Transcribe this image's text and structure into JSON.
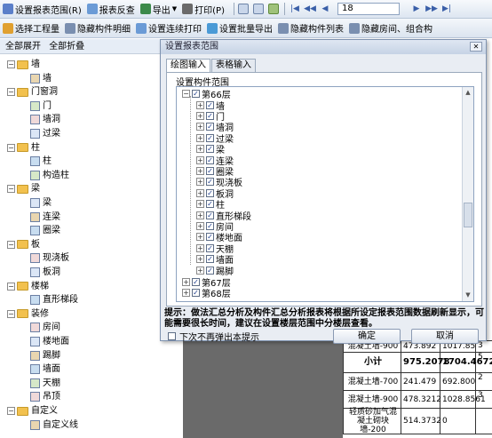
{
  "toolbar1": {
    "items": [
      {
        "label": "设置报表范围(R)",
        "icon": "range-icon",
        "color": "#5b7fc9"
      },
      {
        "label": "报表反查",
        "icon": "reverse-lookup-icon",
        "color": "#6b9bd6"
      },
      {
        "label": "导出",
        "icon": "export-icon",
        "color": "#3c8a4a"
      },
      {
        "label": "打印(P)",
        "icon": "print-icon",
        "color": "#6a6a6a"
      }
    ],
    "page_value": "18"
  },
  "toolbar2": {
    "items": [
      {
        "label": "选择工程量",
        "icon": "select-quantity-icon",
        "color": "#e0a030"
      },
      {
        "label": "隐藏构件明细",
        "icon": "hide-detail-icon",
        "color": "#7a8fb0"
      },
      {
        "label": "设置连续打印",
        "icon": "continuous-print-icon",
        "color": "#6b9bd6"
      },
      {
        "label": "设置批量导出",
        "icon": "batch-export-icon",
        "color": "#4a9ad6"
      },
      {
        "label": "隐藏构件列表",
        "icon": "hide-list-icon",
        "color": "#7a8fb0"
      },
      {
        "label": "隐藏房间、组合构",
        "icon": "hide-room-icon",
        "color": "#7a8fb0"
      }
    ]
  },
  "leftpanel": {
    "expand_all": "全部展开",
    "collapse_all": "全部折叠",
    "tree": [
      {
        "level": 0,
        "type": "folder",
        "label": "墙"
      },
      {
        "level": 1,
        "type": "leaf",
        "label": "墙"
      },
      {
        "level": 0,
        "type": "folder",
        "label": "门窗洞"
      },
      {
        "level": 1,
        "type": "leaf",
        "label": "门"
      },
      {
        "level": 1,
        "type": "leaf",
        "label": "墙洞"
      },
      {
        "level": 1,
        "type": "leaf",
        "label": "过梁"
      },
      {
        "level": 0,
        "type": "folder",
        "label": "柱"
      },
      {
        "level": 1,
        "type": "leaf",
        "label": "柱"
      },
      {
        "level": 1,
        "type": "leaf",
        "label": "构造柱"
      },
      {
        "level": 0,
        "type": "folder",
        "label": "梁"
      },
      {
        "level": 1,
        "type": "leaf",
        "label": "梁"
      },
      {
        "level": 1,
        "type": "leaf",
        "label": "连梁"
      },
      {
        "level": 1,
        "type": "leaf",
        "label": "圈梁"
      },
      {
        "level": 0,
        "type": "folder",
        "label": "板"
      },
      {
        "level": 1,
        "type": "leaf",
        "label": "现浇板"
      },
      {
        "level": 1,
        "type": "leaf",
        "label": "板洞"
      },
      {
        "level": 0,
        "type": "folder",
        "label": "楼梯"
      },
      {
        "level": 1,
        "type": "leaf",
        "label": "直形梯段"
      },
      {
        "level": 0,
        "type": "folder",
        "label": "装修"
      },
      {
        "level": 1,
        "type": "leaf",
        "label": "房间"
      },
      {
        "level": 1,
        "type": "leaf",
        "label": "楼地面"
      },
      {
        "level": 1,
        "type": "leaf",
        "label": "踢脚"
      },
      {
        "level": 1,
        "type": "leaf",
        "label": "墙面"
      },
      {
        "level": 1,
        "type": "leaf",
        "label": "天棚"
      },
      {
        "level": 1,
        "type": "leaf",
        "label": "吊顶"
      },
      {
        "level": 0,
        "type": "folder",
        "label": "自定义"
      },
      {
        "level": 1,
        "type": "leaf",
        "label": "自定义线"
      }
    ]
  },
  "dialog": {
    "title": "设置报表范围",
    "close": "✕",
    "tabs": [
      "绘图输入",
      "表格输入"
    ],
    "group_label": "设置构件范围",
    "floor_top": "第66层",
    "components": [
      "墙",
      "门",
      "墙洞",
      "过梁",
      "梁",
      "连梁",
      "圈梁",
      "现浇板",
      "板洞",
      "柱",
      "直形梯段",
      "房间",
      "楼地面",
      "天棚",
      "墙面",
      "踢脚"
    ],
    "floor_next": "第67层",
    "floor_next2": "第68层",
    "hint_label": "提示：",
    "hint_text": "做法汇总分析及构件汇总分析报表将根据所设定报表范围数据刷新显示，可能需要很长时间，建议在设置楼层范围中分楼层查看。",
    "checkbox_label": "下次不再弹出本提示",
    "ok": "确定",
    "cancel": "取消"
  },
  "report_rows": [
    {
      "name": "混凝土墙-900",
      "v1": "473.892",
      "v2": "1017.85",
      "v3": "3"
    },
    {
      "name": "小计",
      "v1": "975.2078",
      "v2": "1704.4672",
      "v3": "5"
    },
    {
      "name": "混凝土墙-700",
      "v1": "241.479",
      "v2": "692.800",
      "v3": "2"
    },
    {
      "name": "混凝土墙-900",
      "v1": "478.3212",
      "v2": "1028.8561",
      "v3": "3"
    },
    {
      "name": "轻质砂加气混凝土砌块墙-200",
      "v1": "514.3732",
      "v2": "0",
      "v3": ""
    }
  ]
}
